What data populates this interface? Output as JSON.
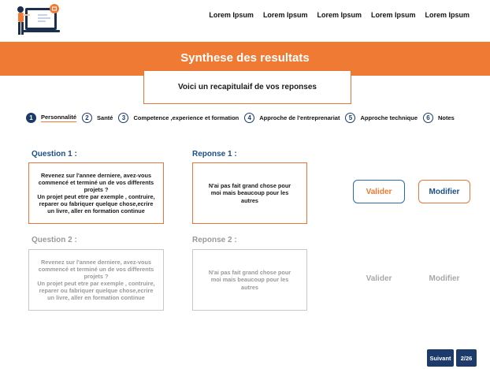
{
  "nav": {
    "items": [
      "Lorem Ipsum",
      "Lorem Ipsum",
      "Lorem Ipsum",
      "Lorem Ipsum",
      "Lorem Ipsum"
    ]
  },
  "banner": {
    "title": "Synthese des resultats",
    "subtitle": "Voici un recapitulaif de vos reponses"
  },
  "steps": [
    {
      "num": "1",
      "label": "Personnalité",
      "active": true
    },
    {
      "num": "2",
      "label": "Santé"
    },
    {
      "num": "3",
      "label": "Competence ,experience et formation"
    },
    {
      "num": "4",
      "label": "Approche de l'entreprenariat"
    },
    {
      "num": "5",
      "label": "Approche technique"
    },
    {
      "num": "6",
      "label": "Notes"
    }
  ],
  "questions": [
    {
      "q_title": "Question 1 :",
      "q_text": "Revenez sur l'annee derniere, avez-vous commencé et terminé un de vos differents projets ?\nUn projet peut etre par exemple , contruire, reparer ou fabriquer quelque chose,ecrire un livre, aller en formation continue",
      "r_title": "Reponse 1 :",
      "r_text": "N'ai pas fait grand chose pour moi mais beaucoup pour les autres",
      "valider": "Valider",
      "modifier": "Modifier"
    },
    {
      "q_title": "Question 2 :",
      "q_text": "Revenez sur l'annee derniere, avez-vous commencé et terminé un de vos differents projets ?\nUn projet peut etre par exemple , contruire, reparer ou fabriquer quelque chose,ecrire un livre, aller en formation continue",
      "r_title": "Reponse 2 :",
      "r_text": "N'ai pas fait grand chose pour moi mais beaucoup pour les autres",
      "valider": "Valider",
      "modifier": "Modifier"
    }
  ],
  "footer": {
    "next_label": "Suivant",
    "page_count": "2/26"
  },
  "colors": {
    "accent": "#ee7a33",
    "primary": "#1c3b6b",
    "question_title": "#1c4f86"
  },
  "icons": {
    "logo": "person-with-laptop-illustration"
  }
}
